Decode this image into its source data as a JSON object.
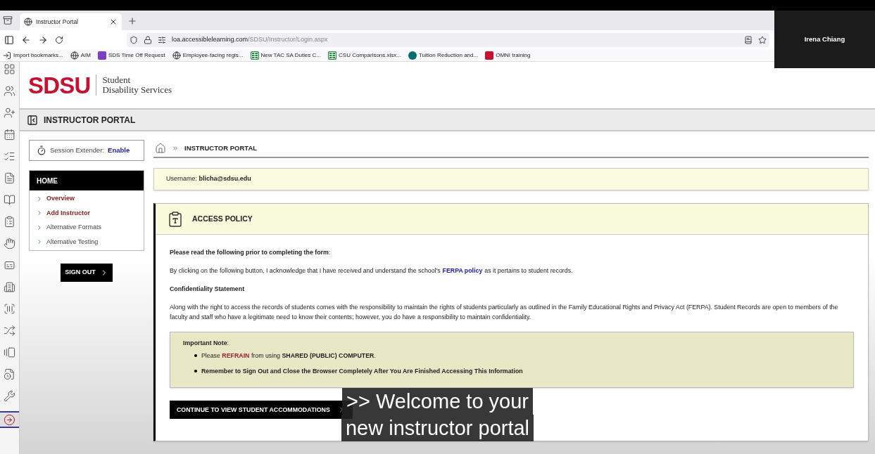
{
  "browser": {
    "tabs": [
      {
        "title": "Instructor Portal",
        "selected": true
      }
    ],
    "url": {
      "host": "loa.accessiblelearning.com",
      "path": "/SDSU/Instructor/Login.aspx"
    },
    "bookmarks": [
      {
        "label": "Import bookmarks...",
        "kind": "import"
      },
      {
        "label": "AIM",
        "kind": "globe"
      },
      {
        "label": "SDS Time Off Request",
        "kind": "form"
      },
      {
        "label": "Employee-facing regis...",
        "kind": "globe"
      },
      {
        "label": "New TAC SA Duties C...",
        "kind": "sheet"
      },
      {
        "label": "CSU Comparisons.xlsx...",
        "kind": "sheet"
      },
      {
        "label": "Tuition Reduction and...",
        "kind": "share"
      },
      {
        "label": "OMNI training",
        "kind": "sd"
      }
    ]
  },
  "participant": {
    "name": "Irena Chiang"
  },
  "rail": [
    {
      "kind": "grid",
      "selected": false
    },
    {
      "kind": "users",
      "selected": false
    },
    {
      "kind": "user-plus",
      "selected": false
    },
    {
      "kind": "calendar",
      "selected": false
    },
    {
      "kind": "checklist",
      "selected": false
    },
    {
      "kind": "document",
      "selected": false
    },
    {
      "kind": "book",
      "selected": false
    },
    {
      "kind": "clipboard",
      "selected": false
    },
    {
      "kind": "hand",
      "selected": false
    },
    {
      "kind": "captions",
      "selected": false
    },
    {
      "kind": "building",
      "selected": false
    },
    {
      "kind": "barcode",
      "selected": false
    },
    {
      "kind": "shuffle",
      "selected": false
    },
    {
      "kind": "cards",
      "selected": false
    },
    {
      "kind": "file-clock",
      "selected": false
    },
    {
      "kind": "tools",
      "selected": false
    },
    {
      "kind": "sign-in",
      "selected": true
    }
  ],
  "logo": {
    "mark": "SDSU",
    "line1": "Student",
    "line2": "Disability Services"
  },
  "portal_title": "INSTRUCTOR PORTAL",
  "session": {
    "label": "Session Extender:",
    "action": "Enable"
  },
  "nav": {
    "title": "HOME",
    "items": [
      {
        "label": "Overview",
        "highlighted": true
      },
      {
        "label": "Add Instructor",
        "highlighted": true
      },
      {
        "label": "Alternative Formats",
        "highlighted": false
      },
      {
        "label": "Alternative Testing",
        "highlighted": false
      }
    ]
  },
  "sign_out": "SIGN OUT",
  "breadcrumb": "INSTRUCTOR PORTAL",
  "username": "Username: **blicha@sdsu.edu**",
  "policy": {
    "title": "ACCESS POLICY",
    "intro": "**Please read the following prior to completing the form**:",
    "ack": {
      "before": "By clicking on the following button, I acknowledge that I have received and understand the school's",
      "link": "FERPA policy",
      "after": "as it pertains to student records."
    },
    "heading": "Confidentiality Statement",
    "statement": "Along with the right to access the records of students comes with the responsibility to maintain the rights of students particularly as outlined in the Family Educational Rights and Privacy Act (FERPA). Student Records are open to members of the faculty and staff who have a legitimate need to know their contents; however, you do have a responsibility to maintain confidentiality.",
    "note_title": "**Important Note**:",
    "bullets": [
      [
        {
          "text": "Please ",
          "kind": "plain"
        },
        {
          "text": "REFRAIN",
          "kind": "alert"
        },
        {
          "text": " from using ",
          "kind": "plain"
        },
        {
          "text": "SHARED (PUBLIC) COMPUTER",
          "kind": "bold"
        },
        {
          "text": ".",
          "kind": "plain"
        }
      ],
      [
        {
          "text": "Remember to Sign Out and Close the Browser Completely After You Are Finished Accessing This Information",
          "kind": "bold"
        }
      ]
    ],
    "button": "CONTINUE TO VIEW STUDENT ACCOMMODATIONS"
  },
  "captions": [
    ">> Welcome to your",
    "new instructor portal"
  ]
}
